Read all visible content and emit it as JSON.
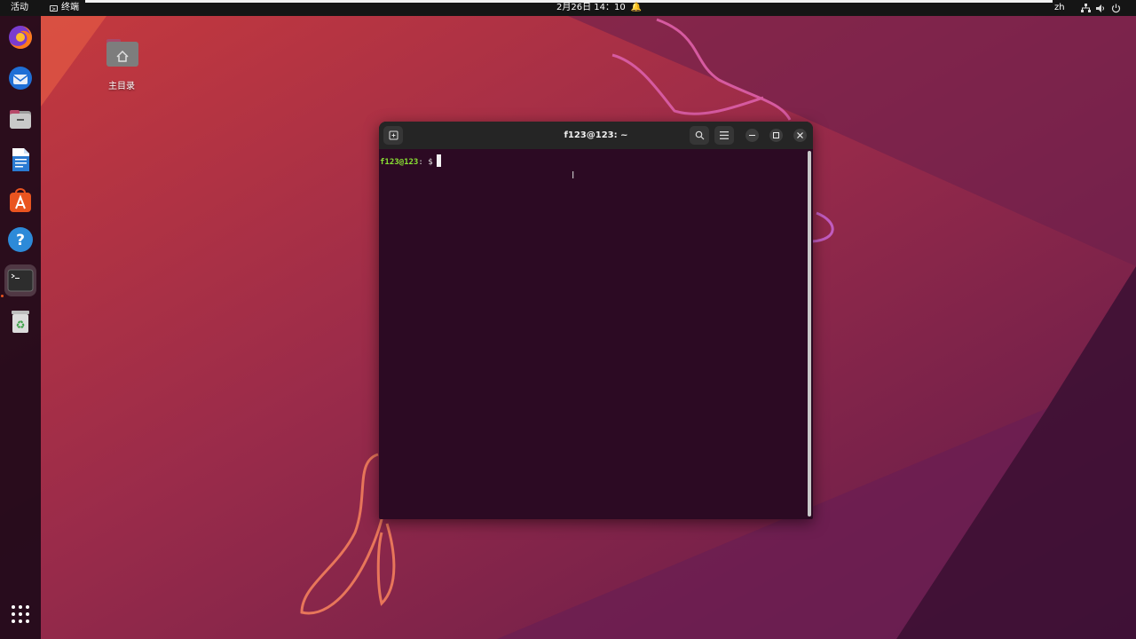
{
  "topbar": {
    "activities": "活动",
    "app_name": "终端",
    "clock": "2月26日 14：10",
    "language": "zh"
  },
  "dock": {
    "items": [
      {
        "name": "firefox-icon"
      },
      {
        "name": "thunderbird-icon"
      },
      {
        "name": "files-icon"
      },
      {
        "name": "writer-icon"
      },
      {
        "name": "app-center-icon"
      },
      {
        "name": "help-icon"
      },
      {
        "name": "terminal-icon",
        "active": true
      },
      {
        "name": "trash-icon"
      }
    ]
  },
  "desktop": {
    "home_label": "主目录"
  },
  "terminal": {
    "title": "f123@123: ~",
    "prompt_user": "f123@123",
    "prompt_rest": ": $"
  },
  "colors": {
    "accent": "#e95420",
    "terminal_bg": "#2c0a23",
    "prompt_green": "#8ae234"
  }
}
